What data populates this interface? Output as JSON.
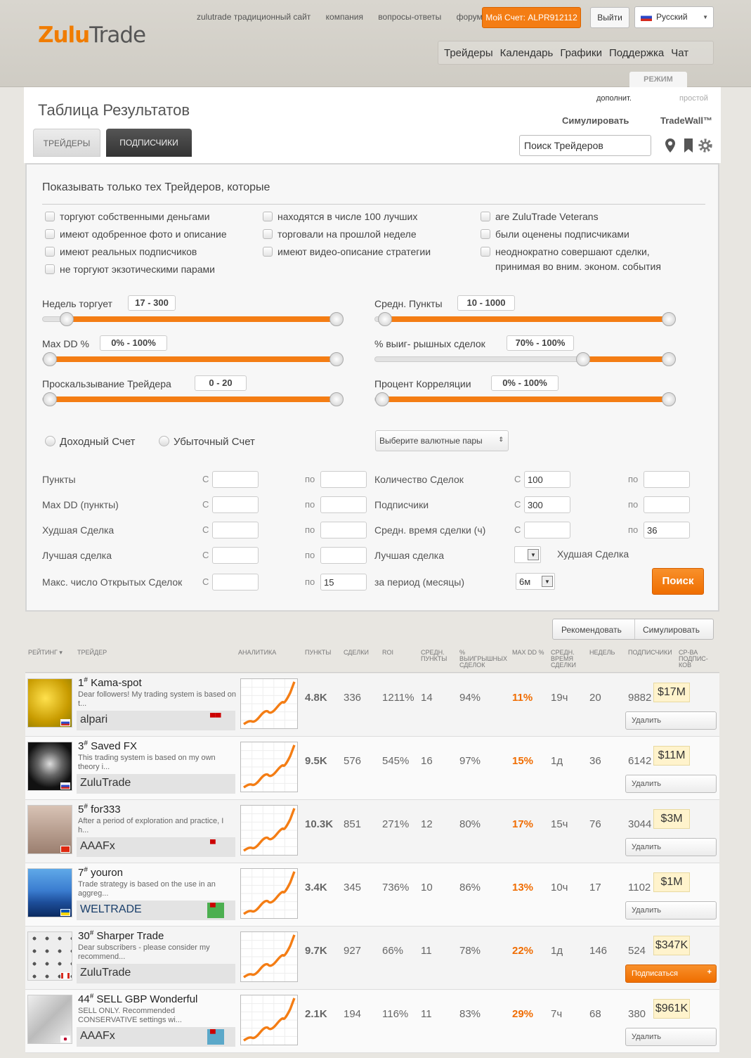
{
  "header": {
    "logo_a": "Zulu",
    "logo_b": "Trade",
    "links": [
      "zulutrade традиционный сайт",
      "компания",
      "вопросы-ответы",
      "форум"
    ],
    "account_button": "Мой Счет: ALPR912112",
    "logout_button": "Выйти",
    "language": "Русский",
    "nav": [
      "Трейдеры",
      "Календарь",
      "Графики",
      "Поддержка",
      "Чат"
    ],
    "mode_tab": "РЕЖИМ"
  },
  "panel": {
    "title": "Таблица Результатов",
    "tab_traders": "ТРЕЙДЕРЫ",
    "tab_subscribers": "ПОДПИСЧИКИ",
    "mode_advanced": "дополнит.",
    "mode_simple": "простой",
    "simulate": "Симулировать",
    "tradewall": "TradeWall™",
    "search_placeholder": "Поиск Трейдеров"
  },
  "filter": {
    "title": "Показывать только тех Трейдеров, которые",
    "checkboxes": [
      "торгуют собственными деньгами",
      "имеют одобренное фото и описание",
      "имеют реальных подписчиков",
      "не торгуют экзотическими парами",
      "находятся в числе 100 лучших",
      "торговали на прошлой неделе",
      "имеют видео-описание стратегии",
      "are ZuluTrade Veterans",
      "были оценены подписчиками",
      "неоднократно совершают сделки,",
      "принимая во вним. эконом. события"
    ],
    "sliders": [
      {
        "label": "Недель торгует",
        "value": "17  - 300",
        "from": 0.06,
        "to": 1.0
      },
      {
        "label": "Max DD %",
        "value": "0% - 100%",
        "from": 0.0,
        "to": 1.0
      },
      {
        "label": "Проскальзывание Трейдера",
        "value": "0 - 20",
        "from": 0.0,
        "to": 1.0
      },
      {
        "label": "Средн. Пункты",
        "value": "10  - 1000",
        "from": 0.01,
        "to": 1.0
      },
      {
        "label": "% выиг- рышных сделок",
        "value": "70% - 100%",
        "from": 0.7,
        "to": 1.0
      },
      {
        "label": "Процент Корреляции",
        "value": "0% - 100%",
        "from": 0.0,
        "to": 1.0
      }
    ],
    "radio_profit": "Доходный Счет",
    "radio_loss": "Убыточный Счет",
    "currency_select": "Выберите валютные пары",
    "from": "С",
    "to": "по",
    "left_fields": [
      {
        "label": "Пункты",
        "from": "",
        "to": ""
      },
      {
        "label": "Max DD (пункты)",
        "from": "",
        "to": ""
      },
      {
        "label": "Худшая Сделка",
        "from": "",
        "to": ""
      },
      {
        "label": "Лучшая сделка",
        "from": "",
        "to": ""
      },
      {
        "label": "Макс. число Открытых Сделок",
        "from": "",
        "to": "15"
      }
    ],
    "right_fields": [
      {
        "label": "Количество Сделок",
        "from": "100",
        "to": ""
      },
      {
        "label": "Подписчики",
        "from": "300",
        "to": ""
      },
      {
        "label": "Средн. время сделки (ч)",
        "from": "",
        "to": "36"
      }
    ],
    "best_trade_label": "Лучшая сделка",
    "worst_trade_label": "Худшая Сделка",
    "period_label": "за период (месяцы)",
    "period_value": "6м",
    "search_button": "Поиск"
  },
  "results": {
    "recommend": "Рекомендовать",
    "simulate": "Симулировать",
    "columns": [
      "РЕЙТИНГ ▾",
      "ТРЕЙДЕР",
      "АНАЛИТИКА",
      "ПУНКТЫ",
      "СДЕЛКИ",
      "ROI",
      "СРЕДН. ПУНКТЫ",
      "% ВЫИГРЫШНЫХ СДЕЛОК",
      "MAX DD %",
      "СРЕДН. ВРЕМЯ СДЕЛКИ",
      "НЕДЕЛЬ",
      "ПОДПИСЧИКИ",
      "СР-ВА ПОДПИС- КОВ"
    ],
    "rows": [
      {
        "rank": "1",
        "name": "Kama-spot",
        "desc": "Dear followers! My trading system is based on t...",
        "broker": "alpari",
        "pips": "4.8K",
        "trades": "336",
        "roi": "1211%",
        "avg_pips": "14",
        "win": "94%",
        "dd": "11%",
        "avg_time": "19ч",
        "weeks": "20",
        "subs": "9882",
        "funds": "$17M",
        "action": "Удалить"
      },
      {
        "rank": "3",
        "name": "Saved FX",
        "desc": "This trading system is based on my own theory i...",
        "broker": "ZuluTrade",
        "pips": "9.5K",
        "trades": "576",
        "roi": "545%",
        "avg_pips": "16",
        "win": "97%",
        "dd": "15%",
        "avg_time": "1д",
        "weeks": "36",
        "subs": "6142",
        "funds": "$11M",
        "action": "Удалить"
      },
      {
        "rank": "5",
        "name": "for333",
        "desc": "After a period of exploration and practice, I h...",
        "broker": "AAAFx",
        "pips": "10.3K",
        "trades": "851",
        "roi": "271%",
        "avg_pips": "12",
        "win": "80%",
        "dd": "17%",
        "avg_time": "15ч",
        "weeks": "76",
        "subs": "3044",
        "funds": "$3M",
        "action": "Удалить"
      },
      {
        "rank": "7",
        "name": "youron",
        "desc": "Trade strategy is based on the use in an aggreg...",
        "broker": "WELTRADE",
        "pips": "3.4K",
        "trades": "345",
        "roi": "736%",
        "avg_pips": "10",
        "win": "86%",
        "dd": "13%",
        "avg_time": "10ч",
        "weeks": "17",
        "subs": "1102",
        "funds": "$1M",
        "action": "Удалить"
      },
      {
        "rank": "30",
        "name": "Sharper Trade",
        "desc": "Dear subscribers - please consider my recommend...",
        "broker": "ZuluTrade",
        "pips": "9.7K",
        "trades": "927",
        "roi": "66%",
        "avg_pips": "11",
        "win": "78%",
        "dd": "22%",
        "avg_time": "1д",
        "weeks": "146",
        "subs": "524",
        "funds": "$347K",
        "action": "Подписаться"
      },
      {
        "rank": "44",
        "name": "SELL GBP Wonderful",
        "desc": "SELL ONLY. Recommended CONSERVATIVE settings wi...",
        "broker": "AAAFx",
        "pips": "2.1K",
        "trades": "194",
        "roi": "116%",
        "avg_pips": "11",
        "win": "83%",
        "dd": "29%",
        "avg_time": "7ч",
        "weeks": "68",
        "subs": "380",
        "funds": "$961K",
        "action": "Удалить"
      }
    ]
  },
  "colors": {
    "accent": "#f47d14",
    "dd": "#f06c00",
    "funds_bg": "#fff3cc"
  }
}
